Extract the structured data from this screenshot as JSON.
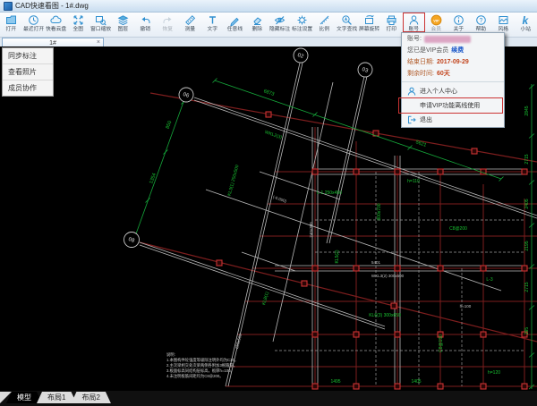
{
  "window": {
    "title": "CAD快速看图 - 1#.dwg"
  },
  "colors": {
    "toolbar_icon_blue": "#2e8fd0",
    "highlight_red": "#cc3333",
    "canvas_green": "#19c532",
    "grid_dark_red": "#7e1e1e",
    "vip_orange": "#f5a623",
    "link_blue": "#1856c8"
  },
  "toolbar": {
    "items": [
      {
        "label": "打开",
        "icon": "open-folder-icon"
      },
      {
        "label": "最近打开",
        "icon": "recent-clock-icon"
      },
      {
        "label": "快看云盘",
        "icon": "cloud-disk-icon"
      },
      {
        "label": "全图",
        "icon": "full-extent-icon"
      },
      {
        "label": "窗口缩放",
        "icon": "window-zoom-icon"
      },
      {
        "label": "图层",
        "icon": "layers-icon"
      },
      {
        "label": "撤销",
        "icon": "undo-icon"
      },
      {
        "label": "恢复",
        "icon": "redo-icon",
        "disabled": true
      },
      {
        "label": "测量",
        "icon": "measure-icon"
      },
      {
        "label": "文字",
        "icon": "text-icon"
      },
      {
        "label": "任意线",
        "icon": "freeline-icon"
      },
      {
        "label": "删除",
        "icon": "eraser-icon"
      },
      {
        "label": "隐藏标注",
        "icon": "hide-annotation-icon"
      },
      {
        "label": "标注设置",
        "icon": "annotation-settings-icon"
      },
      {
        "label": "比例",
        "icon": "scale-icon"
      },
      {
        "label": "文字查找",
        "icon": "find-text-icon"
      },
      {
        "label": "屏幕旋转",
        "icon": "rotate-screen-icon"
      },
      {
        "label": "打印",
        "icon": "print-icon"
      },
      {
        "label": "账号",
        "icon": "account-icon",
        "highlighted": true
      },
      {
        "label": "会员",
        "icon": "vip-icon",
        "muted": true
      },
      {
        "label": "关于",
        "icon": "about-icon"
      },
      {
        "label": "帮助",
        "icon": "help-icon"
      },
      {
        "label": "风格",
        "icon": "style-icon"
      },
      {
        "label": "小站",
        "icon": "ksite-icon"
      }
    ]
  },
  "doc_tabs": {
    "active": "1#",
    "close": "×"
  },
  "quick_menu": {
    "items": [
      {
        "label": "同步标注"
      },
      {
        "label": "查看照片"
      },
      {
        "label": "成员协作"
      }
    ]
  },
  "account_menu": {
    "account_label": "账号:",
    "vip_status": "您已是VIP会员",
    "renew_link": "续费",
    "end_date_label": "结束日期:",
    "end_date": "2017-09-29",
    "remaining_label": "剩余时间:",
    "remaining": "60天",
    "items": [
      {
        "label": "进入个人中心",
        "icon": "person-icon"
      },
      {
        "label": "申请VIP功能离线使用",
        "highlighted": true
      },
      {
        "label": "退出",
        "icon": "logout-icon"
      }
    ]
  },
  "sheet_tabs": {
    "items": [
      {
        "label": "模型",
        "active": true
      },
      {
        "label": "布局1",
        "active": false
      },
      {
        "label": "布局2",
        "active": false
      }
    ]
  },
  "canvas": {
    "bubbles": [
      "02",
      "03",
      "06",
      "08"
    ],
    "top_dims": [
      "6873",
      "5621"
    ],
    "left_dims": [
      "850",
      "1354"
    ],
    "right_dims": [
      "2845",
      "2715",
      "2405",
      "2195",
      "2715",
      "295"
    ],
    "bottom_dims": [
      "1495",
      "1405"
    ],
    "green_labels": [
      "KL3(1) 250x500",
      "WKL2(3)",
      "L-1 250x450",
      "300x700",
      "h=110",
      "KL5(2)",
      "C8@200",
      "KL6(3) 300x650",
      "C8@150",
      "L-3",
      "KL8(1)",
      "h=120"
    ],
    "white_labels": [
      "240x300",
      "WKL3(2) 300x600",
      "(-0.050)",
      "h=100",
      "250x500",
      "5401"
    ],
    "notes": [
      "说明:",
      "1.本图构件砼强度等级除注明外均为C30。",
      "2.主次梁相交处次梁两侧各附加3根箍筋。",
      "3.板面标高同结构层标高，板厚h=100。",
      "4.未注明板筋间距均为C8@200。"
    ]
  }
}
